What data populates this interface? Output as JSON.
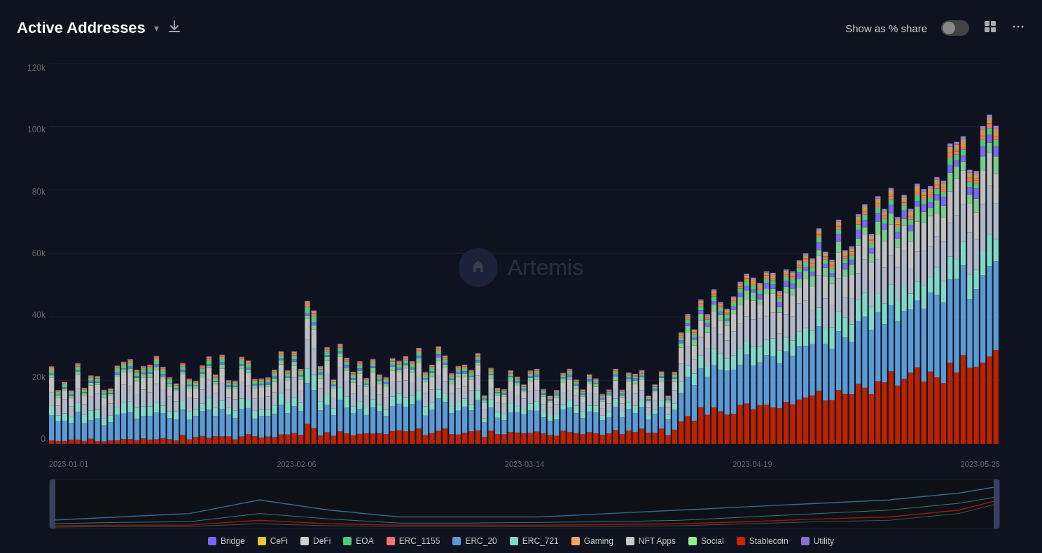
{
  "header": {
    "title": "Active Addresses",
    "chevron": "▾",
    "download_icon": "⬇",
    "show_share_label": "Show as % share",
    "grid_icon": "⊞",
    "more_icon": "···"
  },
  "yAxis": {
    "labels": [
      "120k",
      "100k",
      "80k",
      "60k",
      "40k",
      "20k",
      "0"
    ]
  },
  "xAxis": {
    "labels": [
      "2023-01-01",
      "2023-02-06",
      "2023-03-14",
      "2023-04-19",
      "2023-05-25"
    ]
  },
  "watermark": {
    "text": "Artemis"
  },
  "legend": {
    "items": [
      {
        "label": "Bridge",
        "color": "#7b68ee"
      },
      {
        "label": "CeFi",
        "color": "#f0c040"
      },
      {
        "label": "DeFi",
        "color": "#d0d0d0"
      },
      {
        "label": "EOA",
        "color": "#50c878"
      },
      {
        "label": "ERC_1155",
        "color": "#ff7070"
      },
      {
        "label": "ERC_20",
        "color": "#5b9bd5"
      },
      {
        "label": "ERC_721",
        "color": "#80d8c8"
      },
      {
        "label": "Gaming",
        "color": "#f4a460"
      },
      {
        "label": "NFT Apps",
        "color": "#c8c8c8"
      },
      {
        "label": "Social",
        "color": "#90ee90"
      },
      {
        "label": "Stablecoin",
        "color": "#cc2200"
      },
      {
        "label": "Utility",
        "color": "#8a6fd1"
      }
    ]
  }
}
